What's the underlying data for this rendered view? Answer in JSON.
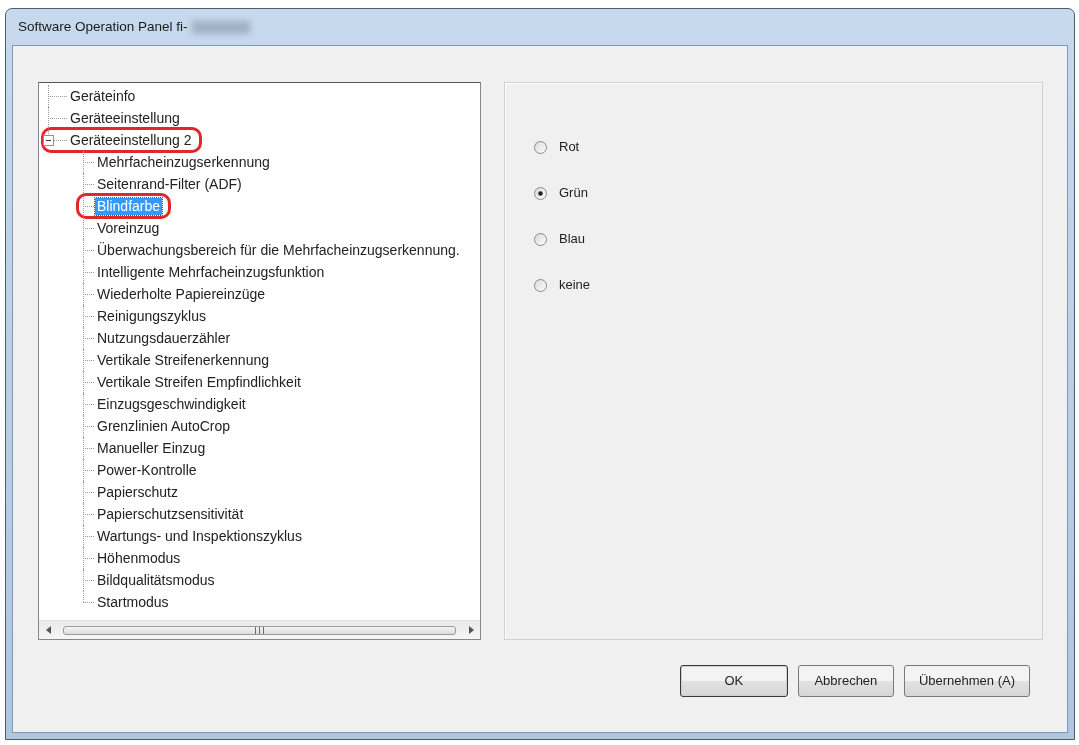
{
  "window": {
    "title": "Software Operation Panel fi-"
  },
  "tree": [
    {
      "label": "Geräteinfo",
      "selected": false,
      "annotated": false
    },
    {
      "label": "Geräteeinstellung",
      "selected": false,
      "annotated": false
    },
    {
      "label": "Geräteeinstellung 2",
      "selected": false,
      "annotated": true,
      "expanded": true,
      "children": [
        {
          "label": "Mehrfacheinzugserkennung",
          "selected": false,
          "annotated": false
        },
        {
          "label": "Seitenrand-Filter (ADF)",
          "selected": false,
          "annotated": false
        },
        {
          "label": "Blindfarbe",
          "selected": true,
          "annotated": true
        },
        {
          "label": "Voreinzug",
          "selected": false,
          "annotated": false
        },
        {
          "label": "Überwachungsbereich für die Mehrfacheinzugserkennung.",
          "selected": false,
          "annotated": false
        },
        {
          "label": "Intelligente Mehrfacheinzugsfunktion",
          "selected": false,
          "annotated": false
        },
        {
          "label": "Wiederholte Papiereinzüge",
          "selected": false,
          "annotated": false
        },
        {
          "label": "Reinigungszyklus",
          "selected": false,
          "annotated": false
        },
        {
          "label": "Nutzungsdauerzähler",
          "selected": false,
          "annotated": false
        },
        {
          "label": "Vertikale Streifenerkennung",
          "selected": false,
          "annotated": false
        },
        {
          "label": "Vertikale Streifen Empfindlichkeit",
          "selected": false,
          "annotated": false
        },
        {
          "label": "Einzugsgeschwindigkeit",
          "selected": false,
          "annotated": false
        },
        {
          "label": "Grenzlinien AutoCrop",
          "selected": false,
          "annotated": false
        },
        {
          "label": "Manueller Einzug",
          "selected": false,
          "annotated": false
        },
        {
          "label": "Power-Kontrolle",
          "selected": false,
          "annotated": false
        },
        {
          "label": "Papierschutz",
          "selected": false,
          "annotated": false
        },
        {
          "label": "Papierschutzsensitivität",
          "selected": false,
          "annotated": false
        },
        {
          "label": "Wartungs- und Inspektionszyklus",
          "selected": false,
          "annotated": false
        },
        {
          "label": "Höhenmodus",
          "selected": false,
          "annotated": false
        },
        {
          "label": "Bildqualitätsmodus",
          "selected": false,
          "annotated": false
        },
        {
          "label": "Startmodus",
          "selected": false,
          "annotated": false
        }
      ]
    }
  ],
  "options": [
    {
      "label": "Rot",
      "selected": false
    },
    {
      "label": "Grün",
      "selected": true
    },
    {
      "label": "Blau",
      "selected": false
    },
    {
      "label": "keine",
      "selected": false
    }
  ],
  "buttons": [
    {
      "label": "OK",
      "default": true
    },
    {
      "label": "Abbrechen",
      "default": false
    },
    {
      "label": "Übernehmen (A)",
      "default": false
    }
  ]
}
